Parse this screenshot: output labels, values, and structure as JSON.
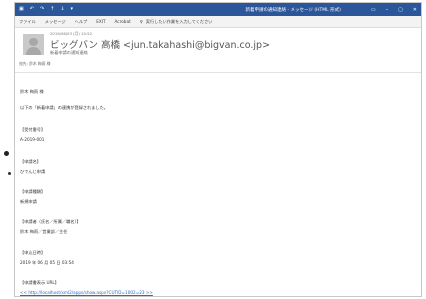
{
  "titlebar": {
    "icons": [
      "save-icon",
      "undo-icon",
      "redo-icon",
      "up-arrow-icon",
      "down-arrow-icon"
    ],
    "title": "新着申請の通知連絡 - メッセージ (HTML 形式)",
    "controls": [
      "minimize-icon",
      "restore-icon",
      "close-icon"
    ]
  },
  "ribbon": {
    "tabs": [
      "ファイル",
      "メッセージ",
      "ヘルプ",
      "EXIT",
      "Acrobat"
    ],
    "tell_me": "実行したい作業を入力してください"
  },
  "email": {
    "date": "2019/06/03 (月) 10:52",
    "sender": "ビッグバン 高橋 <jun.takahashi@bigvan.co.jp>",
    "subject": "新着申請の通知連絡",
    "to": "宛先: 鈴木 梅雨 様"
  },
  "body_lines": [
    "鈴木 梅雨 様",
    "以下の「新着申請」の連携が登録されました。",
    "【受付番号】",
    "A-2019-001",
    "【申請名】",
    "ひでんじ申請",
    "【申請種類】",
    "新規申請",
    "【申請者（氏名／所属／職名）】",
    "鈴木 梅雨／営業部／主任",
    "【申込日時】",
    "2019 年 06 月 05 日 03:54",
    "【申請書表示 URL】",
    "<< http://localhost/xml2/apps/show.aspx?CUTID=1002=23 >>"
  ]
}
